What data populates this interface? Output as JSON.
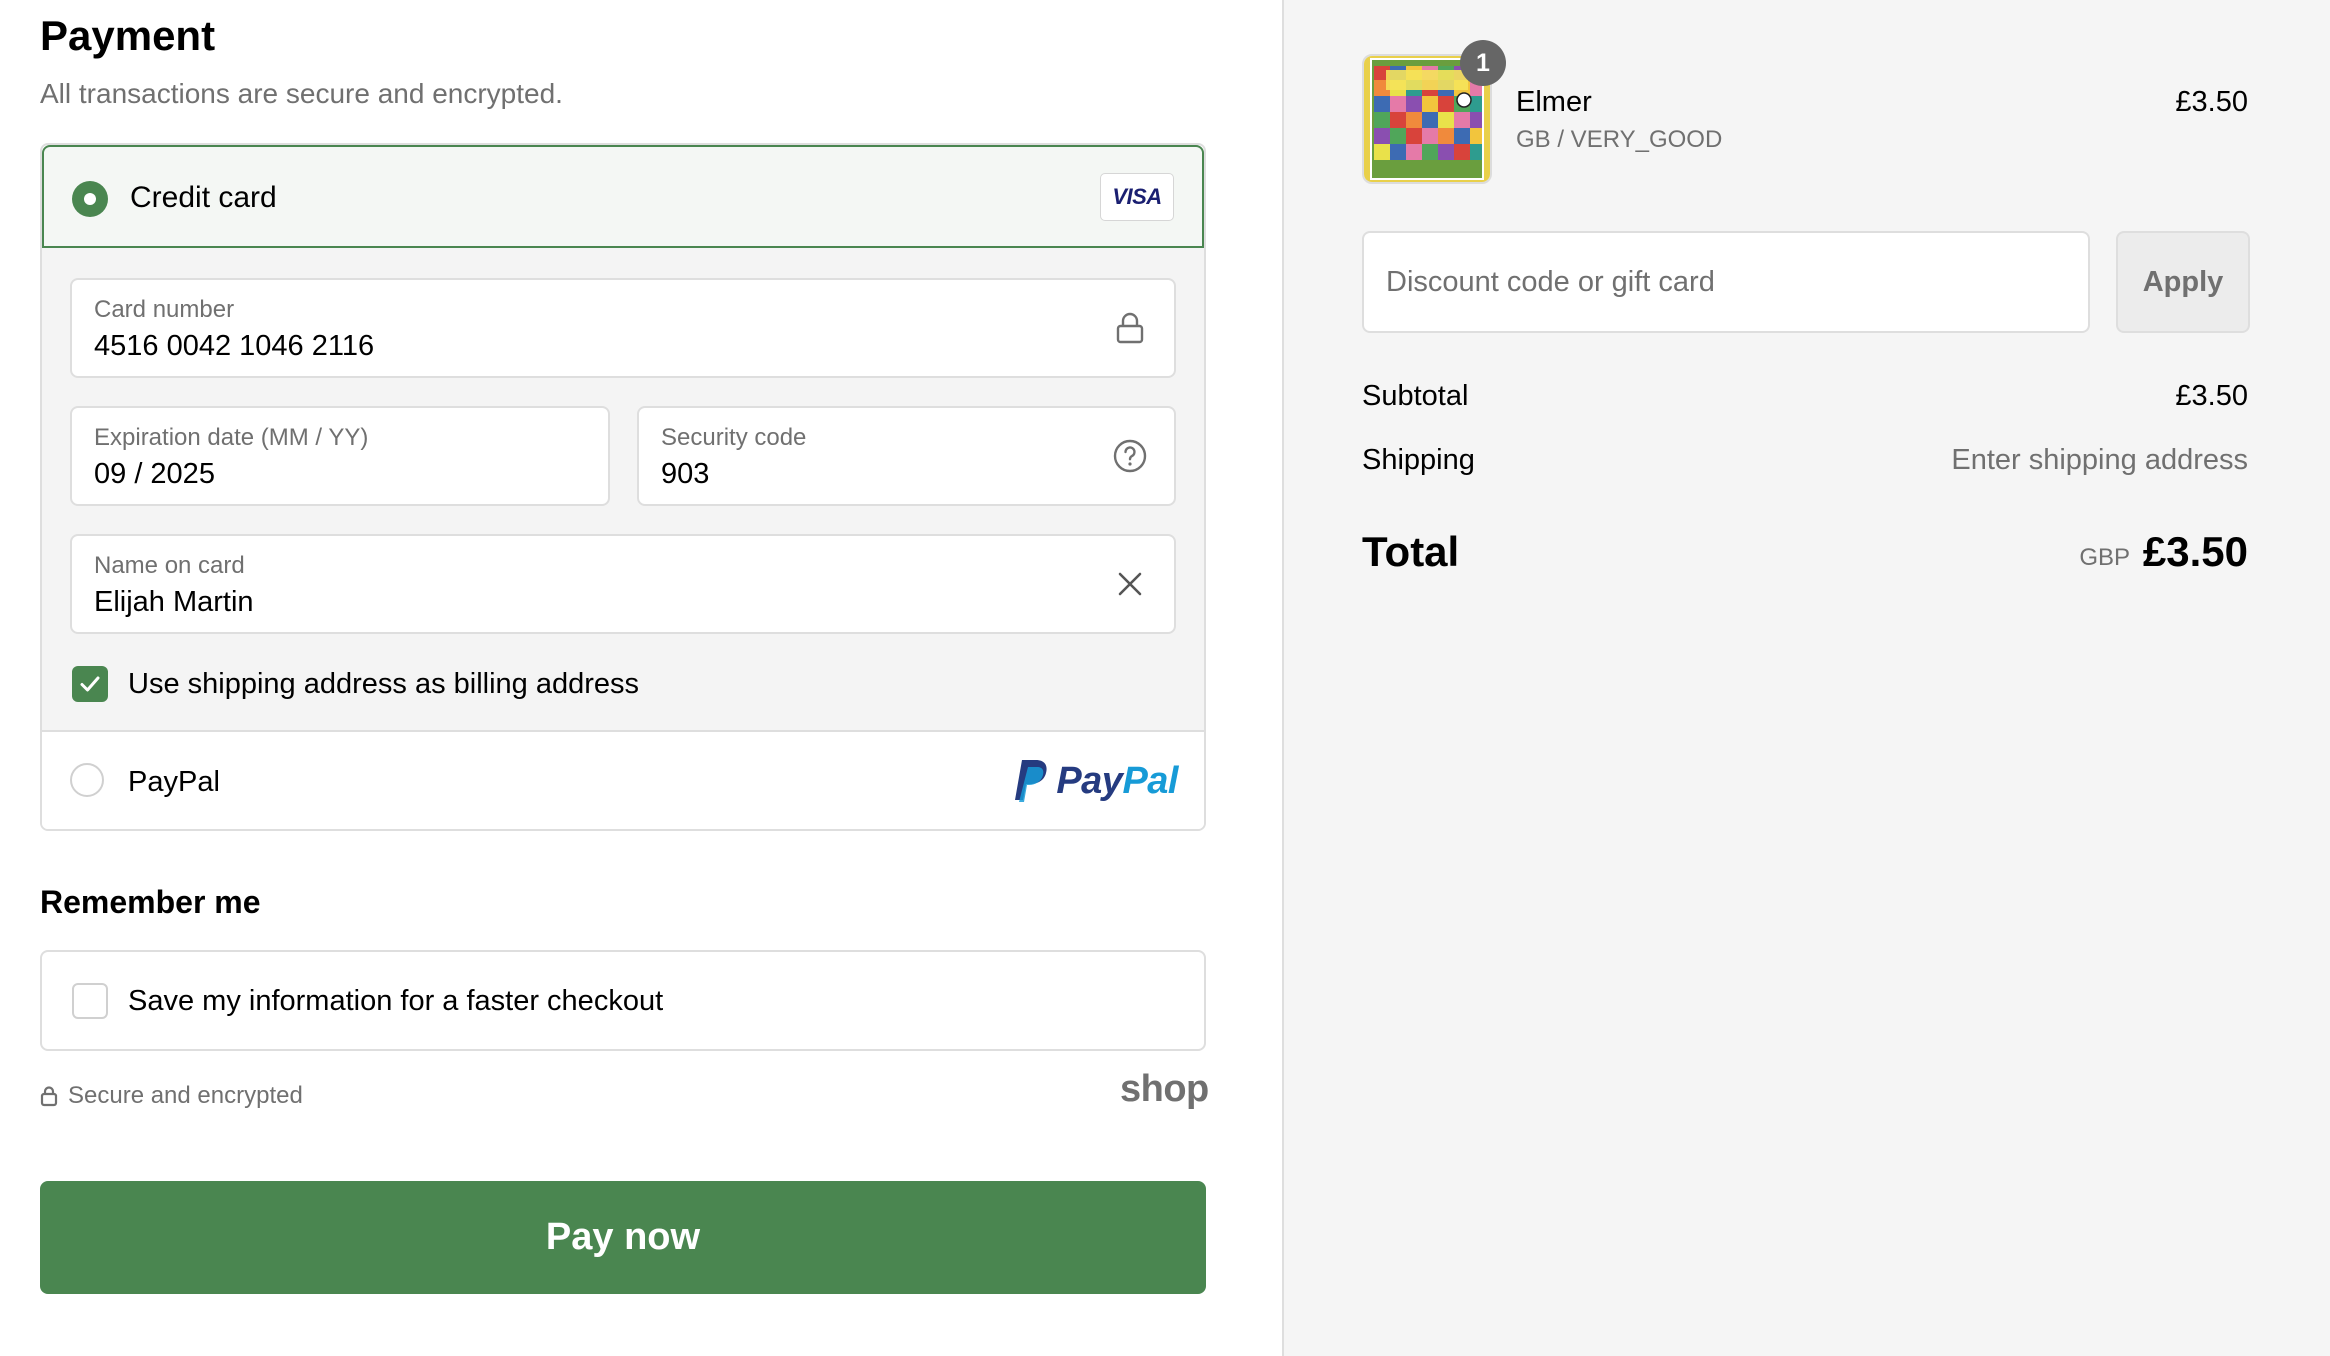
{
  "payment": {
    "title": "Payment",
    "subtitle": "All transactions are secure and encrypted.",
    "credit_card": {
      "label": "Credit card",
      "brand_badge": "VISA",
      "card_number_label": "Card number",
      "card_number_value": "4516 0042 1046 2116",
      "expiration_label": "Expiration date (MM / YY)",
      "expiration_value": "09 / 2025",
      "security_label": "Security code",
      "security_value": "903",
      "name_label": "Name on card",
      "name_value": "Elijah Martin",
      "billing_checkbox_label": "Use shipping address as billing address"
    },
    "paypal": {
      "label": "PayPal",
      "logo_pay": "Pay",
      "logo_pal": "Pal"
    }
  },
  "remember": {
    "title": "Remember me",
    "checkbox_label": "Save my information for a faster checkout"
  },
  "footer": {
    "secure_text": "Secure and encrypted",
    "shop_logo": "shop",
    "pay_button": "Pay now"
  },
  "summary": {
    "item": {
      "quantity": "1",
      "name": "Elmer",
      "variant": "GB / VERY_GOOD",
      "price": "£3.50"
    },
    "discount_placeholder": "Discount code or gift card",
    "apply_label": "Apply",
    "subtotal_label": "Subtotal",
    "subtotal_value": "£3.50",
    "shipping_label": "Shipping",
    "shipping_value": "Enter shipping address",
    "total_label": "Total",
    "total_currency": "GBP",
    "total_value": "£3.50"
  },
  "colors": {
    "accent": "#4a8650",
    "muted_text": "#707070",
    "border": "#dedede",
    "summary_bg": "#f5f5f5",
    "paypal_dark": "#253b80",
    "paypal_light": "#179bd7",
    "visa_blue": "#1a1f71"
  }
}
